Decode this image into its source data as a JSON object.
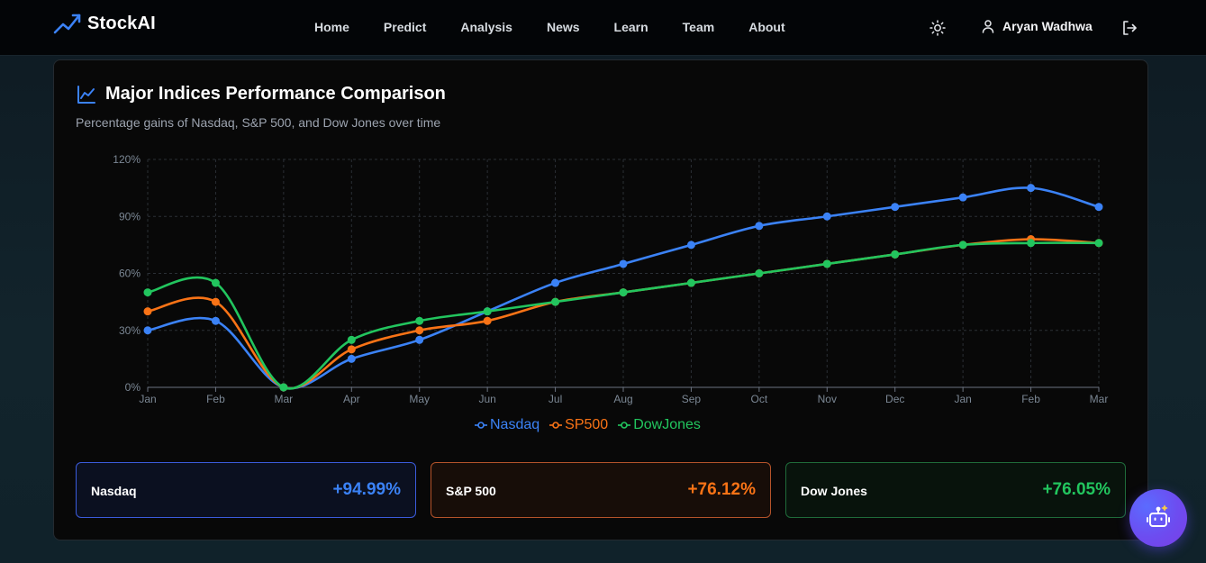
{
  "brand": {
    "name": "StockAI",
    "icon": "trending-up-icon"
  },
  "nav": {
    "links": [
      "Home",
      "Predict",
      "Analysis",
      "News",
      "Learn",
      "Team",
      "About"
    ],
    "theme_icon": "sun-icon",
    "user_icon": "user-icon",
    "user_name": "Aryan Wadhwa",
    "logout_icon": "logout-icon"
  },
  "card": {
    "icon": "line-chart-icon",
    "title": "Major Indices Performance Comparison",
    "subtitle": "Percentage gains of Nasdaq, S&P 500, and Dow Jones over time"
  },
  "chart_data": {
    "type": "line",
    "x": [
      "Jan",
      "Feb",
      "Mar",
      "Apr",
      "May",
      "Jun",
      "Jul",
      "Aug",
      "Sep",
      "Oct",
      "Nov",
      "Dec",
      "Jan",
      "Feb",
      "Mar"
    ],
    "series": [
      {
        "name": "Nasdaq",
        "color": "#3b82f6",
        "values": [
          30,
          35,
          0,
          15,
          25,
          40,
          55,
          65,
          75,
          85,
          90,
          95,
          100,
          105,
          95
        ]
      },
      {
        "name": "SP500",
        "color": "#f97316",
        "values": [
          40,
          45,
          0,
          20,
          30,
          35,
          45,
          50,
          55,
          60,
          65,
          70,
          75,
          78,
          76
        ]
      },
      {
        "name": "DowJones",
        "color": "#22c55e",
        "values": [
          50,
          55,
          0,
          25,
          35,
          40,
          45,
          50,
          55,
          60,
          65,
          70,
          75,
          76,
          76
        ]
      }
    ],
    "y_ticks": [
      "0%",
      "30%",
      "60%",
      "90%",
      "120%"
    ],
    "ylim": [
      0,
      120
    ],
    "grid": true,
    "legend": "bottom-center"
  },
  "stats": [
    {
      "label": "Nasdaq",
      "value": "+94.99%",
      "color": "#3b82f6",
      "border": "#3b5bdb",
      "bg": "#0b1020"
    },
    {
      "label": "S&P 500",
      "value": "+76.12%",
      "color": "#f97316",
      "border": "#b4532a",
      "bg": "#170d08"
    },
    {
      "label": "Dow Jones",
      "value": "+76.05%",
      "color": "#22c55e",
      "border": "#1f6b3a",
      "bg": "#08130c"
    }
  ],
  "chatbot": {
    "icon": "robot-icon"
  }
}
